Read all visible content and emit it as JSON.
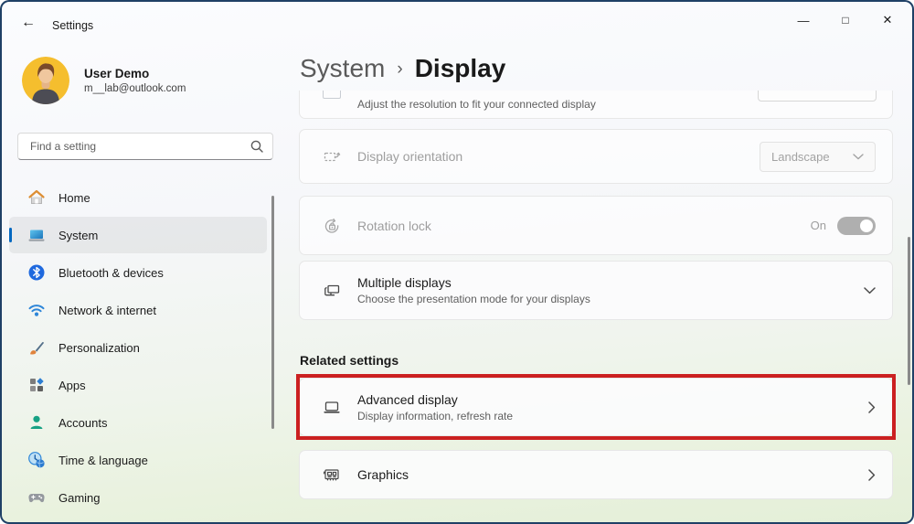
{
  "colors": {
    "accent": "#0067C0",
    "annotation_red": "#CB2020",
    "window_frame": "#1F4066"
  },
  "titlebar": {
    "back_icon": "←",
    "title": "Settings",
    "controls": {
      "minimize": "—",
      "maximize": "□",
      "close": "✕"
    }
  },
  "profile": {
    "name": "User Demo",
    "email": "m__lab@outlook.com"
  },
  "search": {
    "placeholder": "Find a setting",
    "icon": "search-icon"
  },
  "sidebar": {
    "items": [
      {
        "label": "Home",
        "icon": "home-icon"
      },
      {
        "label": "System",
        "icon": "system-icon",
        "selected": true
      },
      {
        "label": "Bluetooth & devices",
        "icon": "bluetooth-icon"
      },
      {
        "label": "Network & internet",
        "icon": "network-icon"
      },
      {
        "label": "Personalization",
        "icon": "personalization-icon"
      },
      {
        "label": "Apps",
        "icon": "apps-icon"
      },
      {
        "label": "Accounts",
        "icon": "accounts-icon"
      },
      {
        "label": "Time & language",
        "icon": "time-language-icon"
      },
      {
        "label": "Gaming",
        "icon": "gaming-icon"
      }
    ]
  },
  "breadcrumb": {
    "parent": "System",
    "separator": "›",
    "current": "Display"
  },
  "main": {
    "resolution_card": {
      "subtitle": "Adjust the resolution to fit your connected display"
    },
    "orientation_card": {
      "title": "Display orientation",
      "value": "Landscape",
      "state": "disabled",
      "icon": "display-orientation-icon"
    },
    "rotation_card": {
      "title": "Rotation lock",
      "toggle": "On",
      "state": "disabled",
      "icon": "rotation-lock-icon"
    },
    "multiple_card": {
      "title": "Multiple displays",
      "subtitle": "Choose the presentation mode for your displays",
      "icon": "multiple-displays-icon"
    },
    "related_heading": "Related settings",
    "advanced_card": {
      "title": "Advanced display",
      "subtitle": "Display information, refresh rate",
      "icon": "advanced-display-icon",
      "annotated": true
    },
    "graphics_card": {
      "title": "Graphics",
      "icon": "graphics-icon"
    }
  }
}
